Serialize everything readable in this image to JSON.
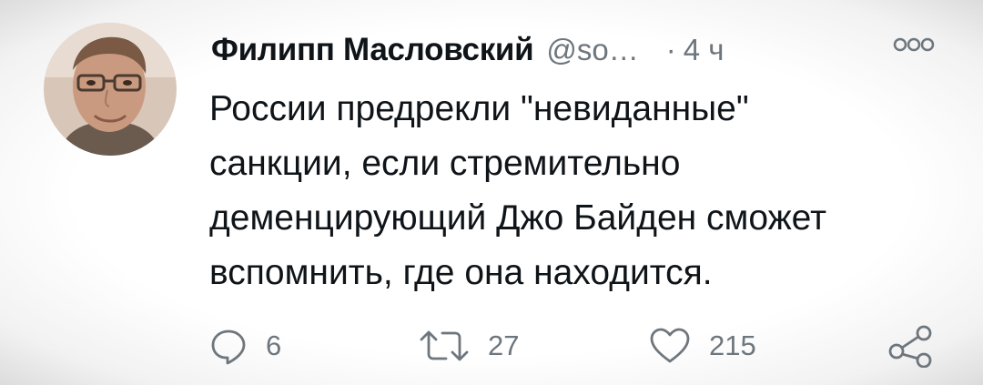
{
  "tweet": {
    "author": {
      "name": "Филипп Масловский",
      "handle": "@so…",
      "avatar": "profile-photo"
    },
    "separator": "·",
    "timestamp": "4 ч",
    "more_icon": "more-dots-icon",
    "text_lines": [
      "России предрекли \"невиданные\"",
      "санкции, если стремительно",
      "деменцирующий Джо Байден сможет",
      "вспомнить, где она находится."
    ],
    "actions": {
      "reply": {
        "icon": "reply-bubble-icon",
        "count": "6"
      },
      "retweet": {
        "icon": "retweet-icon",
        "count": "27"
      },
      "like": {
        "icon": "heart-icon",
        "count": "215"
      },
      "share": {
        "icon": "share-icon"
      }
    },
    "colors": {
      "text": "#0f1419",
      "secondary": "#6e767d",
      "background": "#ffffff"
    }
  }
}
